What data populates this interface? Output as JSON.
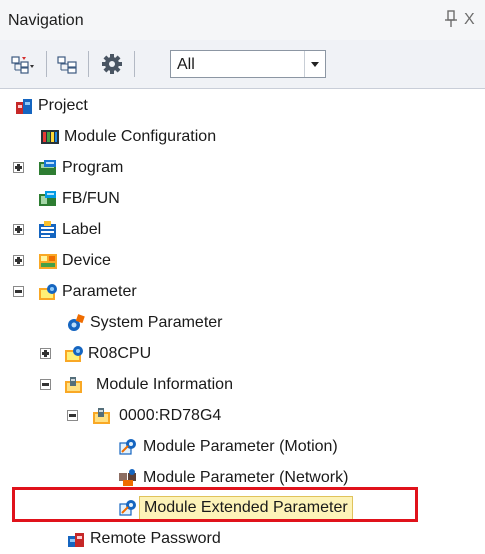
{
  "panel": {
    "title": "Navigation",
    "close_glyph": "X"
  },
  "toolbar": {
    "buttons": [
      "expand-collapse-icon",
      "tree-view-icon",
      "gear-icon"
    ],
    "filter": {
      "value": "All"
    }
  },
  "tree": {
    "items": [
      {
        "label": "Project",
        "icon": "project-icon"
      },
      {
        "label": "Module Configuration",
        "icon": "module-config-icon"
      },
      {
        "label": "Program",
        "icon": "program-icon",
        "expander": "+"
      },
      {
        "label": "FB/FUN",
        "icon": "fbfun-icon"
      },
      {
        "label": "Label",
        "icon": "label-icon",
        "expander": "+"
      },
      {
        "label": "Device",
        "icon": "device-icon",
        "expander": "+"
      },
      {
        "label": "Parameter",
        "icon": "parameter-icon",
        "expander": "-"
      },
      {
        "label": "System Parameter",
        "icon": "system-parameter-icon"
      },
      {
        "label": "R08CPU",
        "icon": "cpu-icon",
        "expander": "+"
      },
      {
        "label": "Module Information",
        "icon": "module-information-icon",
        "expander": "-"
      },
      {
        "label": "0000:RD78G4",
        "icon": "module-icon",
        "expander": "-"
      },
      {
        "label": "Module Parameter (Motion)",
        "icon": "module-parameter-icon"
      },
      {
        "label": "Module Parameter (Network)",
        "icon": "network-parameter-icon"
      },
      {
        "label": "Module Extended Parameter",
        "icon": "extended-parameter-icon",
        "selected": true
      },
      {
        "label": "Remote Password",
        "icon": "remote-password-icon"
      }
    ]
  },
  "colors": {
    "highlight_box": "#e0121b",
    "selection": "#fdf3b8"
  }
}
